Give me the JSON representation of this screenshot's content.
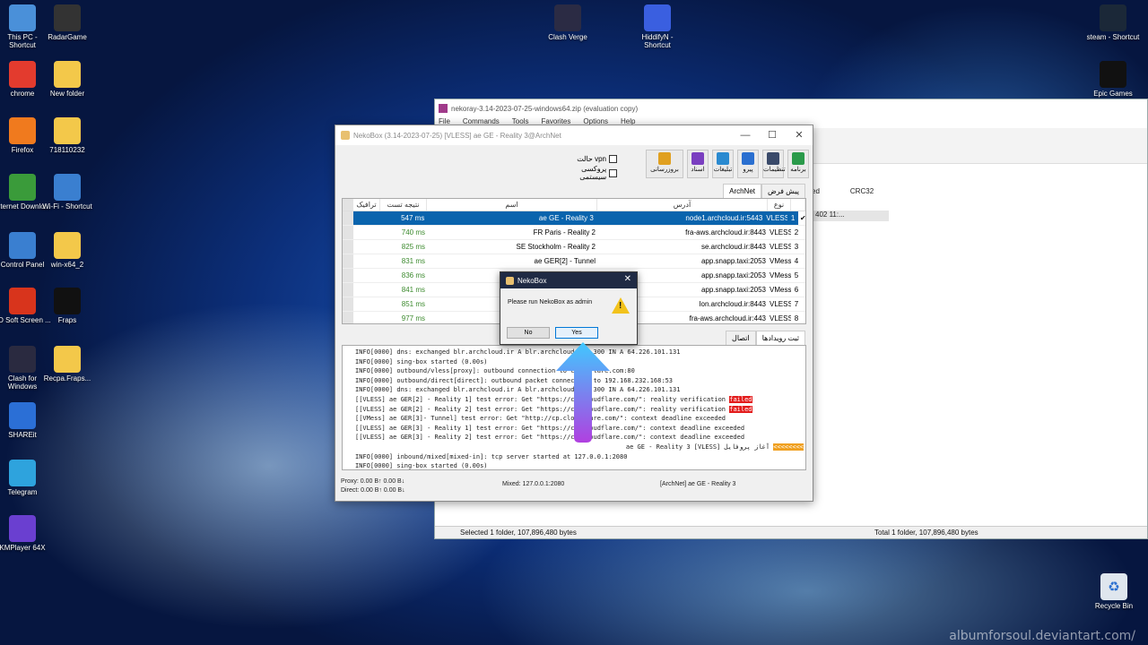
{
  "desktop": {
    "icons_left": [
      {
        "label": "This PC - Shortcut",
        "icon": "pc-icon",
        "color": "#4a90d9"
      },
      {
        "label": "chrome",
        "icon": "chrome-icon",
        "color": "#e33b2e"
      },
      {
        "label": "Firefox",
        "icon": "firefox-icon",
        "color": "#f07a1e"
      },
      {
        "label": "Internet Downlo...",
        "icon": "idm-icon",
        "color": "#3a9b3a"
      },
      {
        "label": "Control Panel",
        "icon": "control-panel-icon",
        "color": "#3a7fd0"
      },
      {
        "label": "ZD Soft Screen ...",
        "icon": "zdsoft-icon",
        "color": "#d8341c"
      },
      {
        "label": "Clash for Windows",
        "icon": "clash-cat-icon",
        "color": "#2a2a40"
      },
      {
        "label": "SHAREit",
        "icon": "shareit-icon",
        "color": "#2b6fd6"
      },
      {
        "label": "Telegram",
        "icon": "telegram-icon",
        "color": "#2ea3dd"
      },
      {
        "label": "KMPlayer 64X",
        "icon": "kmplayer-icon",
        "color": "#6a3fd0"
      }
    ],
    "icons_col2": [
      {
        "label": "RadarGame",
        "icon": "radargame-icon",
        "color": "#333"
      },
      {
        "label": "New folder",
        "icon": "folder-icon",
        "color": "#f3c84a"
      },
      {
        "label": "718110232",
        "icon": "folder-icon",
        "color": "#f3c84a"
      },
      {
        "label": "Wi-Fi - Shortcut",
        "icon": "wifi-icon",
        "color": "#3a7fd0"
      },
      {
        "label": "win-x64_2",
        "icon": "folder-icon",
        "color": "#f3c84a"
      },
      {
        "label": "Fraps",
        "icon": "fraps-icon",
        "color": "#111"
      },
      {
        "label": "Recpa.Fraps...",
        "icon": "folder-icon",
        "color": "#f3c84a"
      }
    ],
    "icons_top": [
      {
        "label": "Clash Verge",
        "icon": "clash-verge-icon",
        "color": "#2b2b44"
      },
      {
        "label": "HiddifyN - Shortcut",
        "icon": "hiddify-icon",
        "color": "#3a5fe0"
      }
    ],
    "icons_right": [
      {
        "label": "steam - Shortcut",
        "icon": "steam-icon",
        "color": "#1b2838"
      },
      {
        "label": "Epic Games",
        "icon": "epic-games-icon",
        "color": "#111"
      }
    ],
    "recycle_bin": {
      "label": "Recycle Bin",
      "icon": "recycle-bin-icon"
    },
    "watermark": "albumforsoul.deviantart.com/"
  },
  "zip_window": {
    "title": "nekoray-3.14-2023-07-25-windows64.zip (evaluation copy)",
    "menu": [
      "File",
      "Commands",
      "Tools",
      "Favorites",
      "Options",
      "Help"
    ],
    "columns": [
      "ed",
      "CRC32"
    ],
    "row_text": "402 11:...",
    "status_left": "Selected 1 folder, 107,896,480 bytes",
    "status_right": "Total 1 folder, 107,896,480 bytes"
  },
  "neko": {
    "title": "NekoBox (3.14-2023-07-25) [VLESS] ae GE - Reality 3@ArchNet",
    "toolbar": [
      {
        "label": "برنامه",
        "icon": "program-icon",
        "color": "#2a9a4a"
      },
      {
        "label": "تنظیمات",
        "icon": "settings-icon",
        "color": "#3a4a6a"
      },
      {
        "label": "پیرو",
        "icon": "server-icon",
        "color": "#2a6fd0"
      },
      {
        "label": "تبلیغات",
        "icon": "globe-icon",
        "color": "#2a8ad0"
      },
      {
        "label": "اسناد",
        "icon": "docs-icon",
        "color": "#7a3fc0"
      },
      {
        "label": "بروزرسانی",
        "icon": "update-icon",
        "color": "#e0a020"
      }
    ],
    "options": {
      "vpn_label": "حالت vpn",
      "system_proxy_label": "پروکسی سیستمی"
    },
    "tabs": [
      "پیش فرض",
      "ArchNet"
    ],
    "table": {
      "headers": [
        "نوع",
        "آدرس",
        "اسم",
        "نتیجه تست",
        "ترافیک"
      ],
      "rows": [
        {
          "idx": "1",
          "type": "VLESS",
          "address": "node1.archcloud.ir:5443",
          "name": "ae GE - Reality 3",
          "test": "547 ms",
          "selected": true
        },
        {
          "idx": "2",
          "type": "VLESS",
          "address": "fra-aws.archcloud.ir:8443",
          "name": "FR Paris - Reality 2",
          "test": "740 ms",
          "selected": false
        },
        {
          "idx": "3",
          "type": "VLESS",
          "address": "se.archcloud.ir:8443",
          "name": "SE Stockholm - Reality 2",
          "test": "825 ms",
          "selected": false
        },
        {
          "idx": "4",
          "type": "VMess",
          "address": "app.snapp.taxi:2053",
          "name": "ae GER[2] - Tunnel",
          "test": "831 ms",
          "selected": false
        },
        {
          "idx": "5",
          "type": "VMess",
          "address": "app.snapp.taxi:2053",
          "name": "",
          "test": "836 ms",
          "selected": false
        },
        {
          "idx": "6",
          "type": "VMess",
          "address": "app.snapp.taxi:2053",
          "name": "",
          "test": "841 ms",
          "selected": false
        },
        {
          "idx": "7",
          "type": "VLESS",
          "address": "lon.archcloud.ir:8443",
          "name": "",
          "test": "851 ms",
          "selected": false
        },
        {
          "idx": "8",
          "type": "VLESS",
          "address": "fra-aws.archcloud.ir:443",
          "name": "",
          "test": "977 ms",
          "selected": false
        }
      ]
    },
    "log_tabs": [
      "ثبت رویدادها",
      "اتصال"
    ],
    "log_lines": [
      "INFO[0000] dns: exchanged blr.archcloud.ir A blr.archcloud.ir. 300 IN A 64.226.101.131",
      "INFO[0000] sing-box started (0.00s)",
      "INFO[0000] outbound/vless[proxy]: outbound connection to cloudflare.com:80",
      "INFO[0000] outbound/direct[direct]: outbound packet connection to 192.168.232.168:53",
      "INFO[0000] dns: exchanged blr.archcloud.ir A blr.archcloud.ir. 300 IN A 64.226.101.131",
      "[[VLESS] ae GER[2] - Reality 1] test error: Get \"https://cp.cloudflare.com/\": reality verification ",
      "[[VLESS] ae GER[2] - Reality 2] test error: Get \"https://cp.cloudflare.com/\": reality verification ",
      "[[VMess] ae GER[3]- Tunnel] test error: Get \"http://cp.cloudflare.com/\": context deadline exceeded",
      "[[VLESS] ae GER[3] - Reality 1] test error: Get \"https://cp.cloudflare.com/\": context deadline exceeded",
      "[[VLESS] ae GER[3] - Reality 2] test error: Get \"https://cp.cloudflare.com/\": context deadline exceeded",
      "ae GE - Reality 3 [VLESS] آغاز پروفایل ",
      "INFO[0000] inbound/mixed[mixed-in]: tcp server started at 127.0.0.1:2080",
      "INFO[0000] sing-box started (0.00s)"
    ],
    "failed_badge": "failed",
    "profile_start_badge": "<<<<<<<<",
    "status": {
      "proxy": "Proxy: 0.00 B↑ 0.00 B↓",
      "direct": "Direct: 0.00 B↑ 0.00 B↓",
      "mixed": "Mixed: 127.0.0.1:2080",
      "current": "[ArchNet] ae GE - Reality 3"
    }
  },
  "dialog": {
    "title": "NekoBox",
    "message": "Please run NekoBox as admin",
    "no_label": "No",
    "yes_label": "Yes"
  },
  "colors": {
    "selection": "#0a64ad",
    "failed": "#e31c1c",
    "highlight": "#f0a020",
    "arrow_top": "#40c8ff",
    "arrow_bottom": "#b040e0"
  }
}
